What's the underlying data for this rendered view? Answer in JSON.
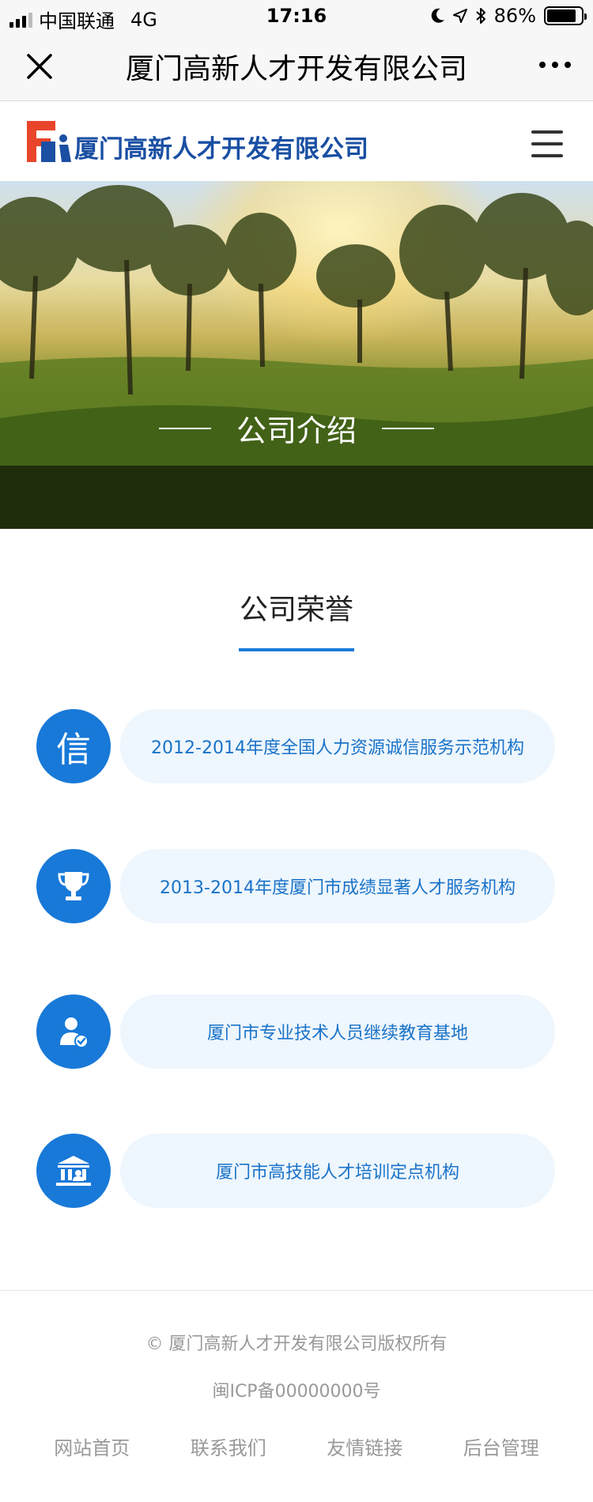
{
  "status_bar": {
    "carrier": "中国联通",
    "network": "4G",
    "time": "17:16",
    "battery": "86%",
    "battery_level": 0.86
  },
  "navbar": {
    "title": "厦门高新人才开发有限公司",
    "close_icon": "close-icon",
    "more_icon": "more-icon"
  },
  "header": {
    "logo_text": "厦门高新人才开发有限公司",
    "menu_icon": "hamburger-menu-icon"
  },
  "banner": {
    "caption": "公司介绍"
  },
  "honors": {
    "title": "公司荣誉",
    "items": [
      {
        "icon": "xin-character-icon",
        "icon_text": "信",
        "label": "2012-2014年度全国人力资源诚信服务示范机构"
      },
      {
        "icon": "trophy-icon",
        "label": "2013-2014年度厦门市成绩显著人才服务机构"
      },
      {
        "icon": "certified-person-icon",
        "label": "厦门市专业技术人员继续教育基地"
      },
      {
        "icon": "institution-icon",
        "label": "厦门市高技能人才培训定点机构"
      }
    ]
  },
  "footer": {
    "copyright": "© 厦门高新人才开发有限公司版权所有",
    "icp": "闽ICP备00000000号",
    "nav": [
      "网站首页",
      "联系我们",
      "友情链接",
      "后台管理"
    ]
  },
  "colors": {
    "accent": "#1879d8",
    "pill_bg": "#eef6fe",
    "pill_text": "#1a73c8",
    "logo_blue": "#1a4fa3",
    "logo_red": "#e8452a"
  }
}
